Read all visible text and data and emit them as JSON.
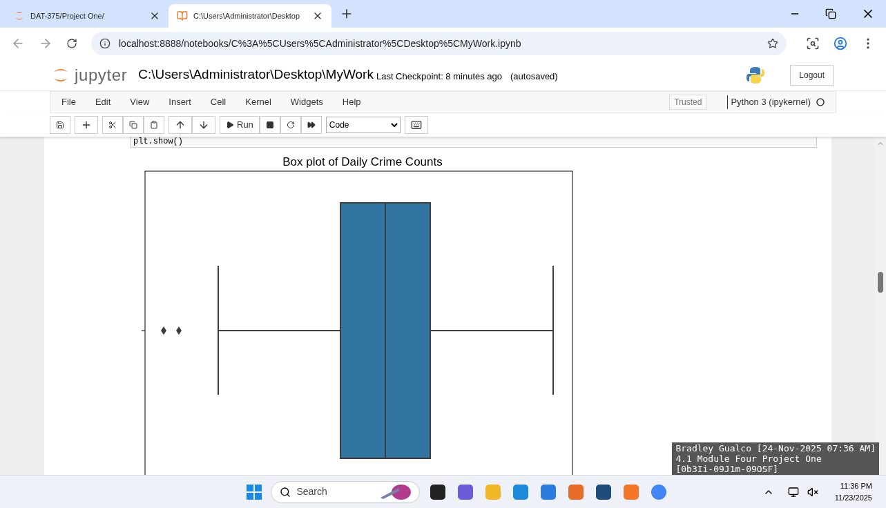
{
  "browser": {
    "tabs": [
      {
        "title": "DAT-375/Project One/",
        "selected": false,
        "kind": "jupyter"
      },
      {
        "title": "C:\\Users\\Administrator\\Desktop",
        "selected": true,
        "kind": "book"
      }
    ],
    "url": "localhost:8888/notebooks/C%3A%5CUsers%5CAdministrator%5CDesktop%5CMyWork.ipynb"
  },
  "notebook": {
    "logo_text": "jupyter",
    "title": "C:\\Users\\Administrator\\Desktop\\MyWork",
    "checkpoint": "Last Checkpoint: 8 minutes ago",
    "autosave": "(autosaved)",
    "logout": "Logout",
    "menu": [
      "File",
      "Edit",
      "View",
      "Insert",
      "Cell",
      "Kernel",
      "Widgets",
      "Help"
    ],
    "trusted": "Trusted",
    "kernel": "Python 3 (ipykernel)",
    "run": "Run",
    "cell_type": "Code",
    "code": "plt.show()",
    "plot_title": "Box plot of Daily Crime Counts"
  },
  "overlay": [
    "Bradley Gualco [24-Nov-2025 07:36 AM]",
    "4.1 Module Four Project One",
    "[0b3Ii-09J1m-09OSF]"
  ],
  "taskbar": {
    "search": "Search",
    "time": "11:36 PM",
    "date": "11/23/2025"
  }
}
